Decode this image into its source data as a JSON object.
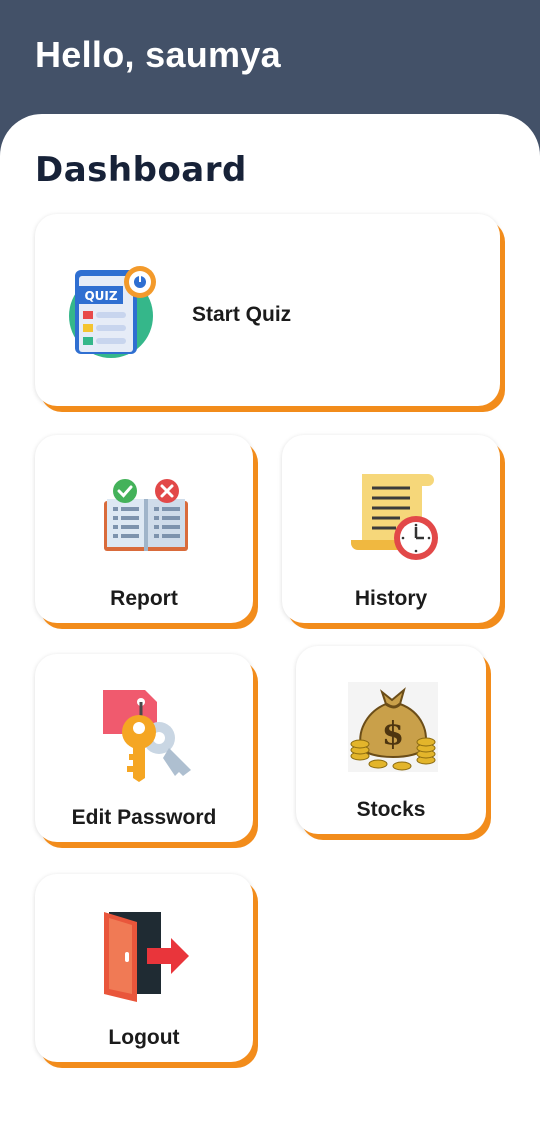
{
  "header": {
    "greeting": "Hello, saumya"
  },
  "dashboard": {
    "title": "Dashboard",
    "cards": [
      {
        "id": "start-quiz",
        "label": "Start Quiz",
        "icon": "quiz-icon"
      },
      {
        "id": "report",
        "label": "Report",
        "icon": "report-book-icon"
      },
      {
        "id": "history",
        "label": "History",
        "icon": "history-scroll-clock-icon"
      },
      {
        "id": "edit-password",
        "label": "Edit Password",
        "icon": "key-tag-icon"
      },
      {
        "id": "stocks",
        "label": "Stocks",
        "icon": "money-bag-icon"
      },
      {
        "id": "logout",
        "label": "Logout",
        "icon": "exit-door-icon"
      }
    ],
    "quiz_icon_text": "QUIZ",
    "stocks_icon_symbol": "$"
  },
  "colors": {
    "header_bg": "#435168",
    "accent_shadow": "#f28c1b",
    "title_text": "#172238"
  }
}
